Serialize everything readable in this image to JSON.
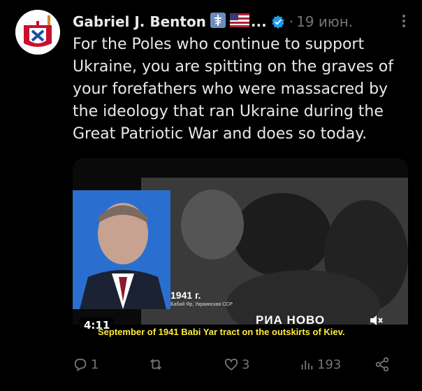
{
  "author": {
    "name": "Gabriel J. Benton",
    "name_suffix": "...",
    "date": "19 июн."
  },
  "tweet": {
    "text": "For the Poles who continue to support\nUkraine, you are spitting on the graves of\nyour forefathers who were massacred by\nthe ideology that ran Ukraine during the\nGreat Patriotic War and does so today."
  },
  "video": {
    "duration": "4:11",
    "subtitle": "September of 1941 Babi Yar tract on the outskirts of Kiev.",
    "caption_year": "1941 г.",
    "caption_place": "Бабий Яр, Украинская ССР",
    "brand": "РИА НОВО"
  },
  "actions": {
    "replies": "1",
    "retweets": "",
    "likes": "3",
    "views": "193"
  },
  "colors": {
    "background": "#000000",
    "text": "#e7e9ea",
    "muted": "#71767b",
    "verified": "#1d9bf0",
    "subtitle": "#ffeb3b"
  },
  "icons": [
    "orthodox-cross-icon",
    "us-flag-icon",
    "verified-badge-icon",
    "more-icon",
    "reply-icon",
    "retweet-icon",
    "like-icon",
    "views-icon",
    "share-icon",
    "mute-icon"
  ]
}
